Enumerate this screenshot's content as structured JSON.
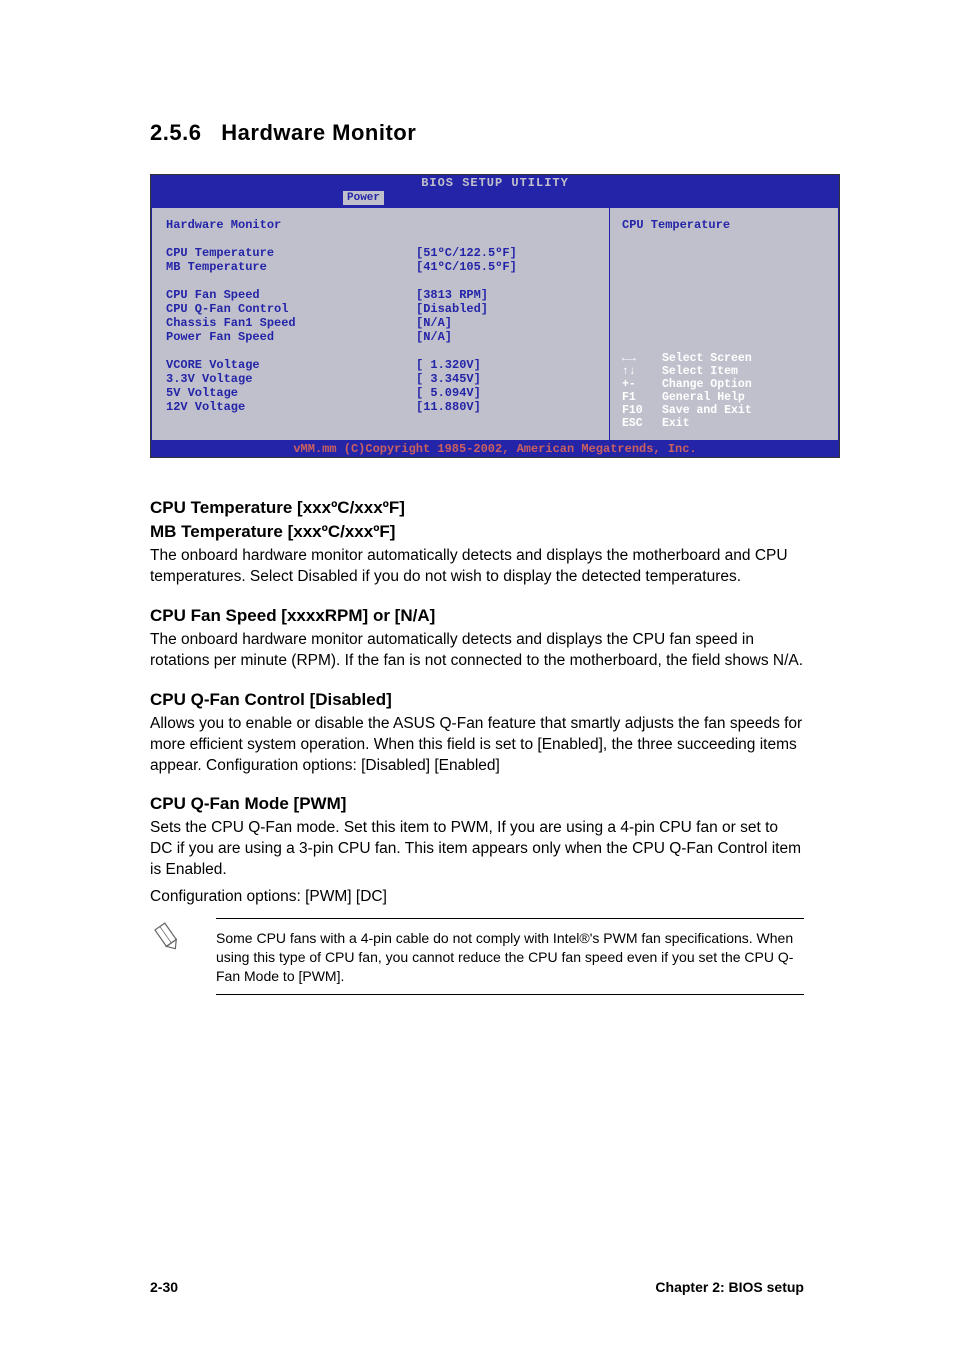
{
  "section_number": "2.5.6",
  "section_title": "Hardware Monitor",
  "bios": {
    "title": "BIOS SETUP UTILITY",
    "tab": "Power",
    "left_title": "Hardware Monitor",
    "rows": [
      [
        {
          "label": "CPU Temperature",
          "value": "[51ºC/122.5ºF]"
        },
        {
          "label": "MB Temperature",
          "value": "[41ºC/105.5ºF]"
        }
      ],
      [
        {
          "label": "CPU Fan Speed",
          "value": "[3813 RPM]"
        },
        {
          "label": "CPU Q-Fan Control",
          "value": "[Disabled]"
        },
        {
          "label": "Chassis Fan1 Speed",
          "value": "[N/A]"
        },
        {
          "label": "Power Fan Speed",
          "value": "[N/A]"
        }
      ],
      [
        {
          "label": "VCORE Voltage",
          "value": "[ 1.320V]"
        },
        {
          "label": "3.3V Voltage",
          "value": "[ 3.345V]"
        },
        {
          "label": "5V Voltage",
          "value": "[ 5.094V]"
        },
        {
          "label": "12V Voltage",
          "value": "[11.880V]"
        }
      ]
    ],
    "right_title": "CPU Temperature",
    "keys": [
      {
        "key": "←→",
        "desc": "Select Screen"
      },
      {
        "key": "↑↓",
        "desc": "Select Item"
      },
      {
        "key": "+-",
        "desc": "Change Option"
      },
      {
        "key": "F1",
        "desc": "General Help"
      },
      {
        "key": "F10",
        "desc": "Save and Exit"
      },
      {
        "key": "ESC",
        "desc": "Exit"
      }
    ],
    "footer": "vMM.mm (C)Copyright 1985-2002, American Megatrends, Inc."
  },
  "sections": {
    "s1_h1": "CPU Temperature [xxxºC/xxxºF]",
    "s1_h2": "MB Temperature [xxxºC/xxxºF]",
    "s1_body": "The onboard hardware monitor automatically detects and displays the motherboard and CPU temperatures. Select Disabled if you do not wish to display the detected temperatures.",
    "s2_h": "CPU Fan Speed [xxxxRPM] or [N/A]",
    "s2_body": "The onboard hardware monitor automatically detects and displays the CPU fan speed in rotations per minute (RPM). If the fan is not connected to the motherboard, the field shows N/A.",
    "s3_h": "CPU Q-Fan Control [Disabled]",
    "s3_body": "Allows you to enable or disable the ASUS Q-Fan feature that smartly adjusts the fan speeds for more efficient system operation. When this field is set to [Enabled], the three succeeding items appear. Configuration options: [Disabled] [Enabled]",
    "s4_h": "CPU Q-Fan Mode [PWM]",
    "s4_body1": "Sets the CPU Q-Fan mode. Set this item to PWM, If you are using a 4-pin CPU fan or set to DC if you are using a 3-pin CPU fan. This item appears only when the CPU Q-Fan Control item is Enabled.",
    "s4_body2": "Configuration options: [PWM] [DC]"
  },
  "note": "Some CPU fans with a 4-pin cable do not comply with Intel®'s PWM fan specifications. When using this type of CPU fan, you cannot reduce the CPU fan speed even if you set the CPU Q-Fan Mode to [PWM].",
  "footer_left": "2-30",
  "footer_right": "Chapter 2: BIOS setup"
}
